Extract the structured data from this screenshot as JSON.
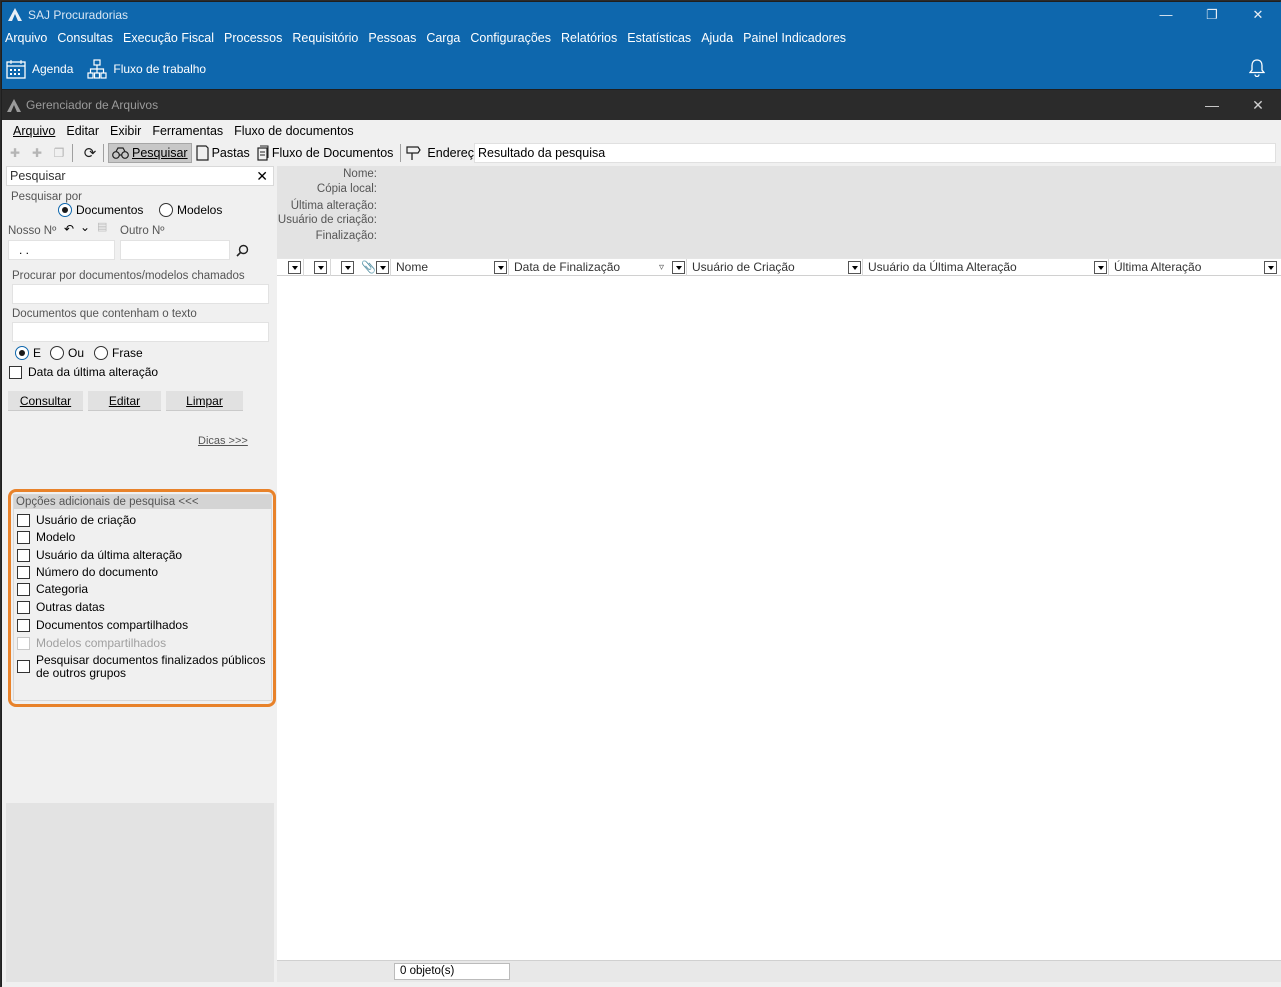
{
  "app": {
    "title": "SAJ Procuradorias",
    "menu": [
      "Arquivo",
      "Consultas",
      "Execução Fiscal",
      "Processos",
      "Requisitório",
      "Pessoas",
      "Carga",
      "Configurações",
      "Relatórios",
      "Estatísticas",
      "Ajuda",
      "Painel Indicadores"
    ],
    "toolbar": {
      "agenda": "Agenda",
      "workflow": "Fluxo de trabalho"
    }
  },
  "child": {
    "title": "Gerenciador de Arquivos",
    "menu": [
      "Arquivo",
      "Editar",
      "Exibir",
      "Ferramentas",
      "Fluxo de documentos"
    ],
    "toolbar": {
      "search": "Pesquisar",
      "folders": "Pastas",
      "doc_flow": "Fluxo de Documentos",
      "address_label": "Endereço",
      "address_value": "Resultado da pesquisa"
    }
  },
  "search_panel": {
    "header": "Pesquisar",
    "search_by_label": "Pesquisar por",
    "radio_documents": "Documentos",
    "radio_models": "Modelos",
    "our_number_label": "Nosso Nº",
    "our_number_value": ". .",
    "other_number_label": "Outro Nº",
    "name_search_label": "Procurar por documentos/modelos chamados",
    "text_search_label": "Documentos que contenham o texto",
    "op_and": "E",
    "op_or": "Ou",
    "op_phrase": "Frase",
    "tips": "Dicas >>>",
    "last_change_date": "Data da última alteração",
    "btn_query": "Consultar",
    "btn_edit": "Editar",
    "btn_clear": "Limpar",
    "advanced": {
      "header": "Opções adicionais de pesquisa <<<",
      "options": [
        "Usuário de criação",
        "Modelo",
        "Usuário da última alteração",
        "Número do documento",
        "Categoria",
        "Outras datas",
        "Documentos compartilhados",
        "Modelos compartilhados",
        "Pesquisar documentos finalizados públicos de outros grupos"
      ]
    }
  },
  "details": {
    "name": "Nome:",
    "local_copy": "Cópia local:",
    "last_change": "Última alteração:",
    "creator": "Usuário de criação:",
    "finalization": "Finalização:"
  },
  "grid": {
    "columns": [
      "Nome",
      "Data de Finalização",
      "Usuário de Criação",
      "Usuário da Última Alteração",
      "Última Alteração"
    ]
  },
  "status": {
    "count": "0 objeto(s)"
  }
}
